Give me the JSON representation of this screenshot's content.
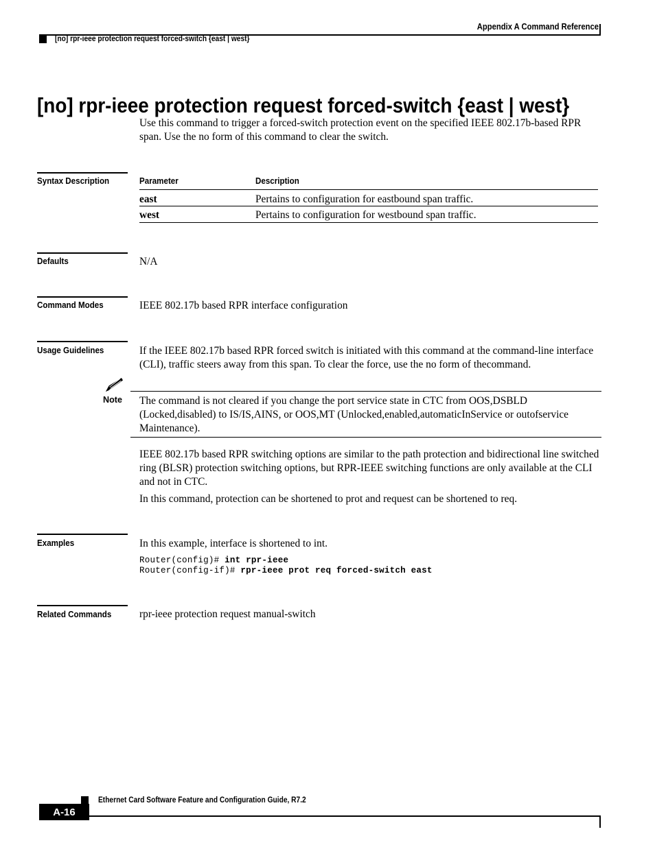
{
  "header": {
    "right_title": "Appendix A Command Reference",
    "command_crumb": "[no] rpr-ieee protection request forced-switch {east | west}",
    "marker_icon": "black-square-marker"
  },
  "title": "[no] rpr-ieee protection request forced-switch {east | west}",
  "lead_paragraph": "Use this command to trigger a forced-switch protection event on the specified IEEE 802.17b-based RPR span. Use the no form of this command to clear the switch.",
  "sections": {
    "syntax_description": {
      "label": "Syntax Description",
      "table": {
        "columns": [
          "Parameter",
          "Description"
        ],
        "rows": [
          {
            "parameter": "east",
            "description": "Pertains to configuration for eastbound span traffic."
          },
          {
            "parameter": "west",
            "description": "Pertains to configuration for westbound span traffic."
          }
        ]
      }
    },
    "defaults": {
      "label": "Defaults",
      "value": "N/A"
    },
    "command_modes": {
      "label": "Command Modes",
      "value": "IEEE 802.17b based RPR interface configuration"
    },
    "usage_guidelines": {
      "label": "Usage Guidelines",
      "paragraph_1": "If the IEEE 802.17b based RPR forced switch is initiated with this command at the command-line interface (CLI), traffic steers away from this span. To clear the force, use the no form of thecommand.",
      "note": {
        "icon": "pencil-note-icon",
        "label": "Note",
        "text": "The command is not cleared if you change the port service state in CTC from OOS,DSBLD (Locked,disabled) to IS/IS,AINS, or OOS,MT (Unlocked,enabled,automaticInService or outofservice Maintenance)."
      },
      "paragraph_2": "IEEE 802.17b based RPR switching options are similar to the path protection and bidirectional line switched ring (BLSR) protection switching options, but RPR-IEEE switching functions are only available at the CLI and not in CTC.",
      "paragraph_3": "In this command, protection can be shortened to prot and request can be shortened to req."
    },
    "examples": {
      "label": "Examples",
      "intro": "In this example, interface is shortened to int.",
      "code_lines": [
        {
          "prompt": "Router(config)# ",
          "command": "int rpr-ieee"
        },
        {
          "prompt": "Router(config-if)# ",
          "command": "rpr-ieee prot req forced-switch east"
        }
      ]
    },
    "related_commands": {
      "label": "Related Commands",
      "value": "rpr-ieee protection request manual-switch"
    }
  },
  "footer": {
    "guide_title": "Ethernet Card Software Feature and Configuration Guide, R7.2",
    "page_number": "A-16",
    "marker_icon": "black-square-marker"
  }
}
